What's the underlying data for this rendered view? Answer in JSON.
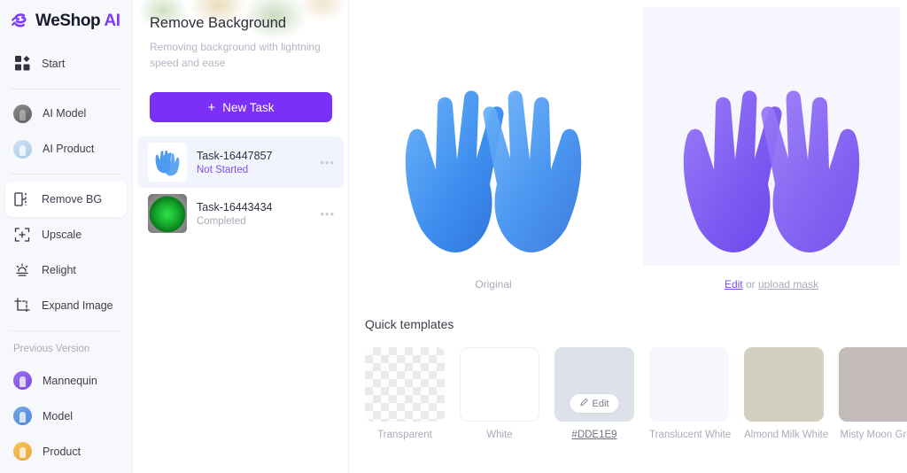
{
  "brand": {
    "name_main": "WeShop",
    "name_accent": "AI",
    "logo_icon": "weshop-s-logo-icon",
    "accent_color": "#7c3cf0"
  },
  "sidebar": {
    "primary": [
      {
        "label": "Start",
        "icon": "grid-squares-icon",
        "active": false
      }
    ],
    "ai_group": [
      {
        "label": "AI Model",
        "icon": "ai-model-avatar-icon",
        "active": false
      },
      {
        "label": "AI Product",
        "icon": "ai-product-avatar-icon",
        "active": false
      }
    ],
    "tools": [
      {
        "label": "Remove BG",
        "icon": "remove-bg-icon",
        "active": true
      },
      {
        "label": "Upscale",
        "icon": "upscale-icon",
        "active": false
      },
      {
        "label": "Relight",
        "icon": "relight-sun-icon",
        "active": false
      },
      {
        "label": "Expand Image",
        "icon": "expand-crop-icon",
        "active": false
      }
    ],
    "previous_version_label": "Previous Version",
    "previous": [
      {
        "label": "Mannequin",
        "icon": "mannequin-avatar-icon"
      },
      {
        "label": "Model",
        "icon": "model-avatar-icon"
      },
      {
        "label": "Product",
        "icon": "product-avatar-icon"
      }
    ]
  },
  "task_panel": {
    "title": "Remove Background",
    "subtitle": "Removing background with lightning speed and ease",
    "new_task_label": "New Task",
    "new_task_icon": "plus-icon",
    "new_task_color": "#7b2ff7",
    "menu_icon": "more-dots-icon",
    "tasks": [
      {
        "name": "Task-16447857",
        "status": "Not Started",
        "status_color": "#7b4ef5",
        "thumb": "blue-gloves-thumb",
        "selected": true
      },
      {
        "name": "Task-16443434",
        "status": "Completed",
        "status_color": "#a8aab8",
        "thumb": "green-light-thumb",
        "selected": false
      }
    ]
  },
  "main": {
    "original": {
      "caption": "Original",
      "image_alt": "blue-nitrile-gloves-crossed"
    },
    "result": {
      "edit_link": "Edit",
      "separator": "or",
      "upload_link": "upload mask",
      "image_alt": "purple-mask-gloves-crossed"
    },
    "templates_title": "Quick templates",
    "templates": [
      {
        "label": "Transparent",
        "kind": "checker",
        "color": "",
        "link": false,
        "edit_badge": false
      },
      {
        "label": "White",
        "kind": "solid",
        "color": "#FFFFFF",
        "link": false,
        "edit_badge": false
      },
      {
        "label": "#DDE1E9",
        "kind": "solid",
        "color": "#DDE1E9",
        "link": true,
        "edit_badge": true,
        "edit_label": "Edit",
        "edit_icon": "pen-edit-icon"
      },
      {
        "label": "Translucent White",
        "kind": "solid",
        "color": "#F5F7FD",
        "link": false,
        "edit_badge": false
      },
      {
        "label": "Almond Milk White",
        "kind": "solid",
        "color": "#D3D0BF",
        "link": false,
        "edit_badge": false
      },
      {
        "label": "Misty Moon Grey",
        "kind": "solid",
        "color": "#C3BCBA",
        "link": false,
        "edit_badge": false
      }
    ]
  }
}
